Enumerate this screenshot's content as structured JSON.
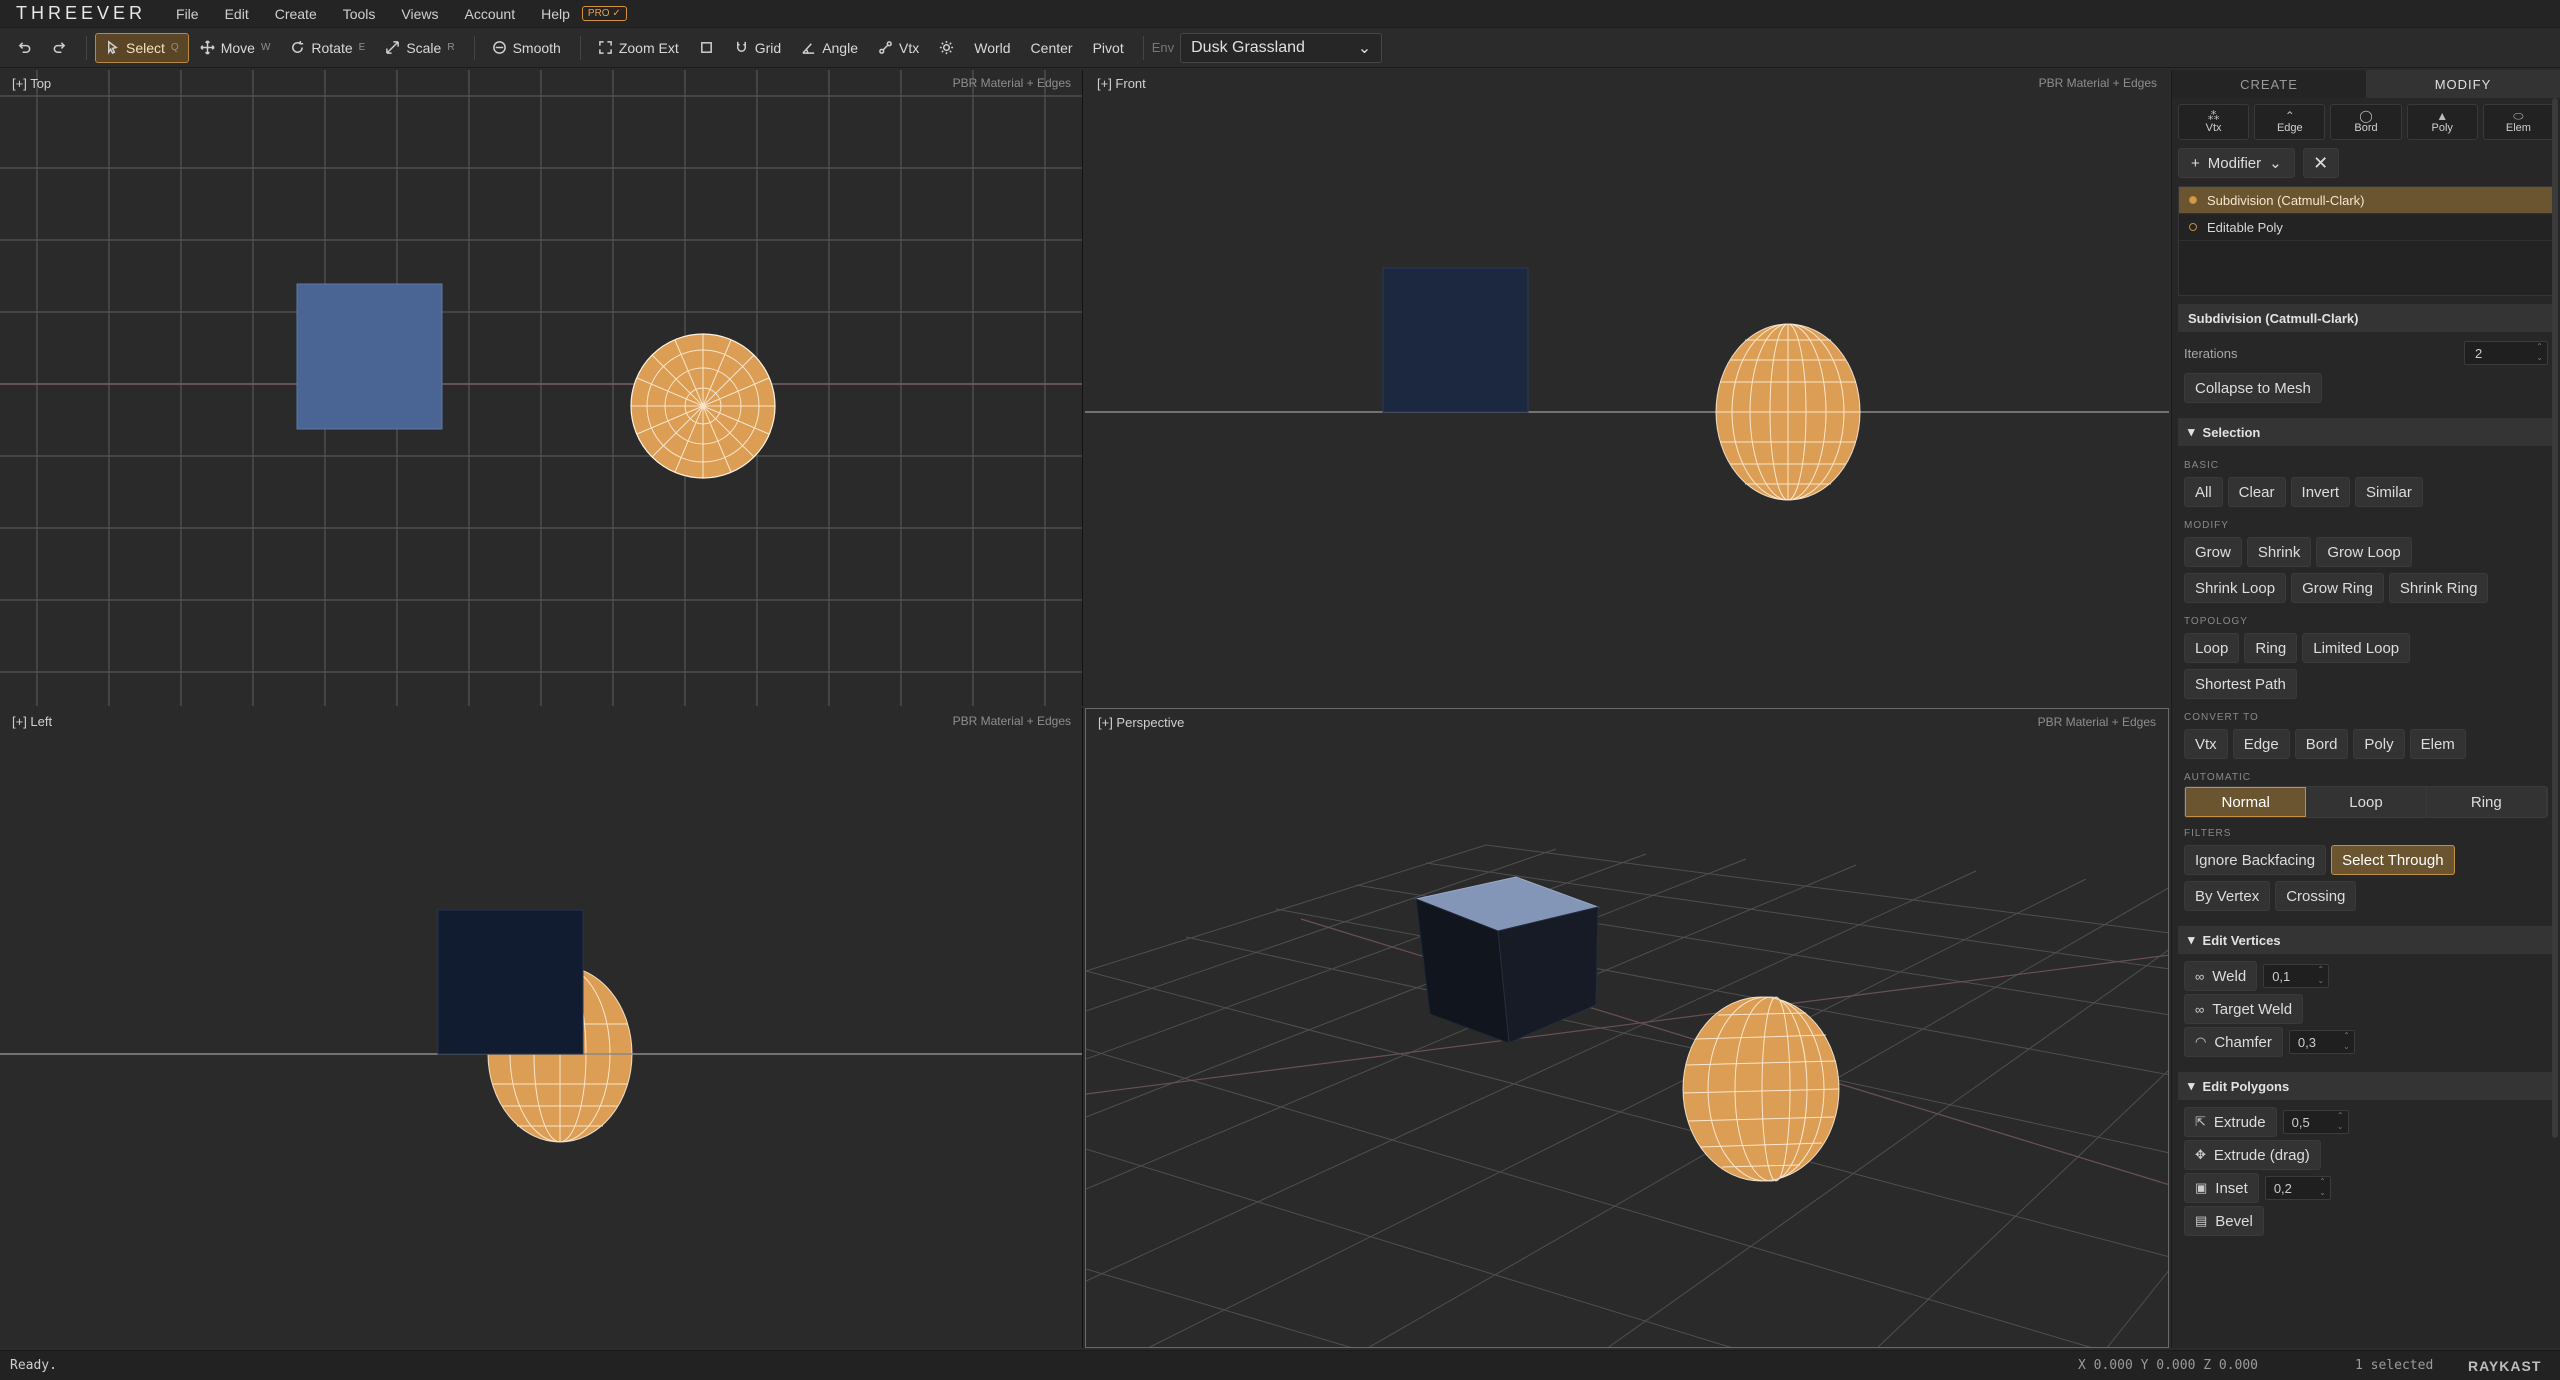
{
  "app": {
    "logo": "THREEVER"
  },
  "menu": {
    "items": [
      "File",
      "Edit",
      "Create",
      "Tools",
      "Views",
      "Account",
      "Help"
    ],
    "pro_badge": "PRO ✓"
  },
  "toolbar": {
    "select": "Select",
    "select_key": "Q",
    "move": "Move",
    "move_key": "W",
    "rotate": "Rotate",
    "rotate_key": "E",
    "scale": "Scale",
    "scale_key": "R",
    "smooth": "Smooth",
    "zoom_ext": "Zoom Ext",
    "grid": "Grid",
    "angle": "Angle",
    "vtx": "Vtx",
    "world": "World",
    "center": "Center",
    "pivot": "Pivot",
    "env_label": "Env",
    "env_value": "Dusk Grassland"
  },
  "viewports": {
    "top": {
      "label": "[+] Top",
      "mode": "PBR Material + Edges"
    },
    "front": {
      "label": "[+] Front",
      "mode": "PBR Material + Edges"
    },
    "left": {
      "label": "[+] Left",
      "mode": "PBR Material + Edges"
    },
    "perspective": {
      "label": "[+] Perspective",
      "mode": "PBR Material + Edges"
    }
  },
  "panel": {
    "tabs": [
      "CREATE",
      "MODIFY"
    ],
    "active_tab": "MODIFY",
    "sublevels": [
      {
        "glyph": "⁂",
        "label": "Vtx"
      },
      {
        "glyph": "⌃",
        "label": "Edge"
      },
      {
        "glyph": "◯",
        "label": "Bord"
      },
      {
        "glyph": "▲",
        "label": "Poly"
      },
      {
        "glyph": "⬭",
        "label": "Elem"
      }
    ],
    "modifier_button": "Modifier",
    "stack": [
      "Subdivision (Catmull-Clark)",
      "Editable Poly"
    ],
    "subdiv": {
      "title": "Subdivision (Catmull-Clark)",
      "iterations_label": "Iterations",
      "iterations_value": "2",
      "collapse": "Collapse to Mesh"
    },
    "selection": {
      "title": "Selection",
      "basic_label": "BASIC",
      "basic": [
        "All",
        "Clear",
        "Invert",
        "Similar"
      ],
      "modify_label": "MODIFY",
      "modify": [
        "Grow",
        "Shrink",
        "Grow Loop",
        "Shrink Loop",
        "Grow Ring",
        "Shrink Ring"
      ],
      "topology_label": "TOPOLOGY",
      "topology": [
        "Loop",
        "Ring",
        "Limited Loop",
        "Shortest Path"
      ],
      "convert_label": "CONVERT TO",
      "convert": [
        "Vtx",
        "Edge",
        "Bord",
        "Poly",
        "Elem"
      ],
      "automatic_label": "AUTOMATIC",
      "automatic": [
        "Normal",
        "Loop",
        "Ring"
      ],
      "filters_label": "FILTERS",
      "filters": [
        "Ignore Backfacing",
        "Select Through",
        "By Vertex",
        "Crossing"
      ]
    },
    "edit_vertices": {
      "title": "Edit Vertices",
      "weld": "Weld",
      "weld_value": "0,1",
      "target_weld": "Target Weld",
      "chamfer": "Chamfer",
      "chamfer_value": "0,3"
    },
    "edit_polygons": {
      "title": "Edit Polygons",
      "extrude": "Extrude",
      "extrude_value": "0,5",
      "extrude_drag": "Extrude (drag)",
      "inset": "Inset",
      "inset_value": "0,2",
      "bevel": "Bevel"
    }
  },
  "status": {
    "message": "Ready.",
    "coords": "X 0.000 Y 0.000 Z 0.000",
    "selection": "1 selected",
    "brand": "RAYKAST"
  },
  "colors": {
    "accent": "#c39043",
    "active_fill": "#6b5430",
    "sphere": "#e0a45c",
    "box_top": "#4a6594"
  }
}
